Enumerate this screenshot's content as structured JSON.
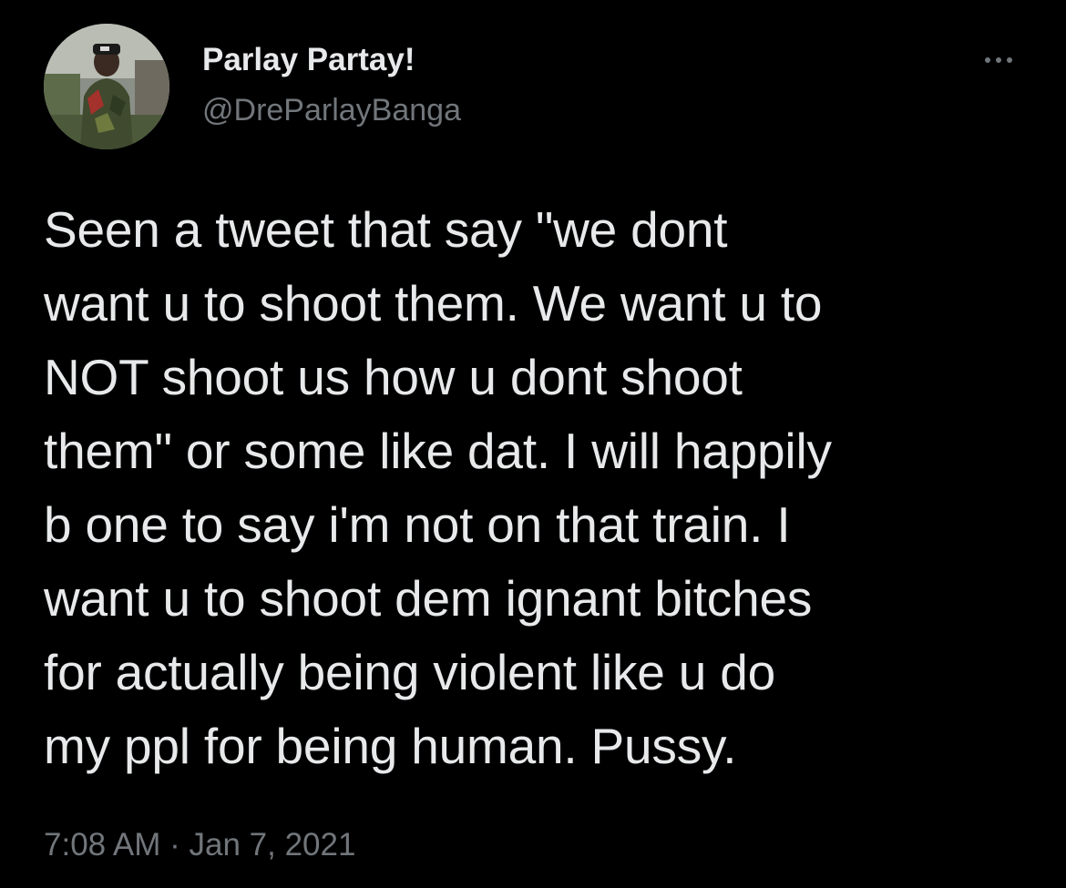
{
  "tweet": {
    "display_name": "Parlay Partay!",
    "handle": "@DreParlayBanga",
    "lines": [
      "Seen a tweet that say \"we dont",
      "want u to shoot them. We want u to",
      "NOT shoot us how u dont shoot",
      "them\" or some like dat. I will happily",
      "b one to say i'm not on that train. I",
      "want u to shoot dem ignant bitches",
      "for actually being violent like u do",
      "my ppl for being human. Pussy."
    ],
    "timestamp": "7:08 AM · Jan 7, 2021"
  },
  "icons": {
    "more": "more-horizontal-icon"
  },
  "colors": {
    "background": "#000000",
    "primary_text": "#e7e9ea",
    "secondary_text": "#71767b"
  }
}
